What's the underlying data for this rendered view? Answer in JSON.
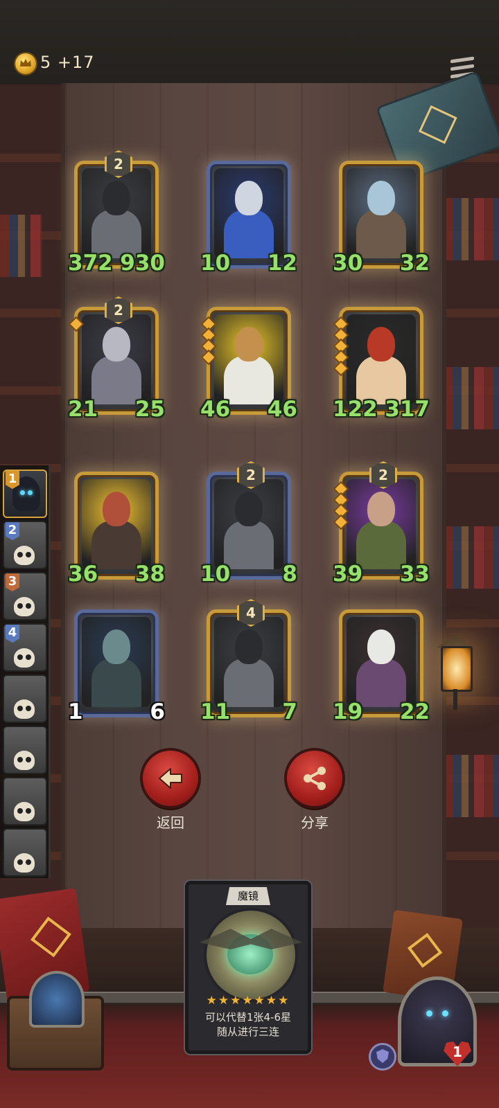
{
  "header": {
    "gold": "5 +17",
    "coin_icon": "crown-coin-icon",
    "menu_icon": "menu-icon"
  },
  "board": [
    {
      "tier": "2",
      "attack": "372",
      "health": "930",
      "frame": "gold",
      "minion": "shield-knight",
      "stars": 0
    },
    {
      "tier": "",
      "attack": "10",
      "health": "12",
      "frame": "steel",
      "minion": "horned-paladin",
      "stars": 0
    },
    {
      "tier": "",
      "attack": "30",
      "health": "32",
      "frame": "gold",
      "minion": "frost-demon",
      "stars": 0
    },
    {
      "tier": "2",
      "attack": "21",
      "health": "25",
      "frame": "gold",
      "minion": "rat-mage",
      "stars": 1
    },
    {
      "tier": "",
      "attack": "46",
      "health": "46",
      "frame": "gold",
      "minion": "sun-priest",
      "stars": 4
    },
    {
      "tier": "",
      "attack": "122",
      "health": "317",
      "frame": "gold",
      "minion": "red-dragon",
      "stars": 5
    },
    {
      "tier": "",
      "attack": "36",
      "health": "38",
      "frame": "gold",
      "minion": "fire-dwarf",
      "stars": 0
    },
    {
      "tier": "2",
      "attack": "10",
      "health": "8",
      "frame": "steel",
      "minion": "shield-knight",
      "stars": 0
    },
    {
      "tier": "2",
      "attack": "39",
      "health": "33",
      "frame": "gold",
      "minion": "grinning-brute",
      "stars": 4
    },
    {
      "tier": "",
      "attack": "1",
      "health": "6",
      "frame": "steel",
      "minion": "fish-man",
      "stars": 0
    },
    {
      "tier": "4",
      "attack": "11",
      "health": "7",
      "frame": "gold",
      "minion": "shield-knight",
      "stars": 0
    },
    {
      "tier": "",
      "attack": "19",
      "health": "22",
      "frame": "gold",
      "minion": "old-hunter",
      "stars": 0
    }
  ],
  "team": [
    {
      "rank": "1",
      "active": true
    },
    {
      "rank": "2",
      "active": false
    },
    {
      "rank": "3",
      "active": false
    },
    {
      "rank": "4",
      "active": false
    },
    {
      "rank": "",
      "active": false
    },
    {
      "rank": "",
      "active": false
    },
    {
      "rank": "",
      "active": false
    },
    {
      "rank": "",
      "active": false
    }
  ],
  "actions": {
    "back_label": "返回",
    "share_label": "分享"
  },
  "spell_card": {
    "name": "魔镜",
    "stars": "★★★★★★★",
    "desc_line1": "可以代替1张4-6星",
    "desc_line2": "随从进行三连"
  },
  "player": {
    "lives": "1"
  },
  "colors": {
    "stat_green": "#98e06c",
    "gold_frame": "#c79a3a",
    "steel_frame": "#596a9a",
    "button_red": "#a31f1c"
  }
}
